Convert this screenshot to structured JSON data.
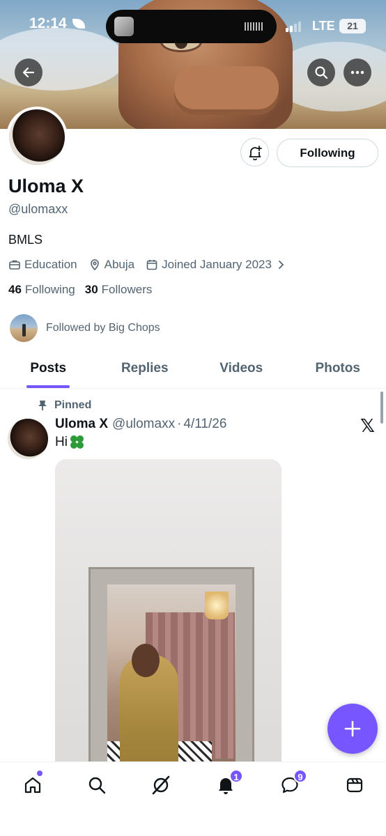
{
  "status_bar": {
    "time": "12:14",
    "network": "LTE",
    "battery": "21"
  },
  "profile": {
    "name": "Uloma X",
    "handle": "@ulomaxx",
    "bio": "BMLS",
    "category": "Education",
    "location": "Abuja",
    "joined": "Joined January 2023",
    "following_count": "46",
    "following_label": "Following",
    "followers_count": "30",
    "followers_label": "Followers",
    "followed_by": "Followed by Big Chops",
    "follow_button_label": "Following"
  },
  "tabs": [
    {
      "label": "Posts",
      "active": true
    },
    {
      "label": "Replies",
      "active": false
    },
    {
      "label": "Videos",
      "active": false
    },
    {
      "label": "Photos",
      "active": false
    }
  ],
  "post": {
    "pinned_label": "Pinned",
    "author_name": "Uloma X",
    "author_handle": "@ulomaxx",
    "separator": "·",
    "date": "4/11/26",
    "text": "Hi",
    "emoji": "four-leaf-clover"
  },
  "bottom_nav": {
    "notifications_badge": "1",
    "messages_badge": "9"
  },
  "colors": {
    "accent": "#7856ff",
    "text_primary": "#0f1419",
    "text_secondary": "#536471"
  },
  "icons": {
    "back": "arrow-left-icon",
    "search": "search-icon",
    "more": "more-icon",
    "notify": "bell-plus-icon",
    "compose": "plus-icon",
    "home": "home-icon",
    "explore": "search-icon",
    "grok": "grok-icon",
    "notifications": "bell-icon",
    "messages": "message-icon",
    "communities": "communities-icon"
  }
}
